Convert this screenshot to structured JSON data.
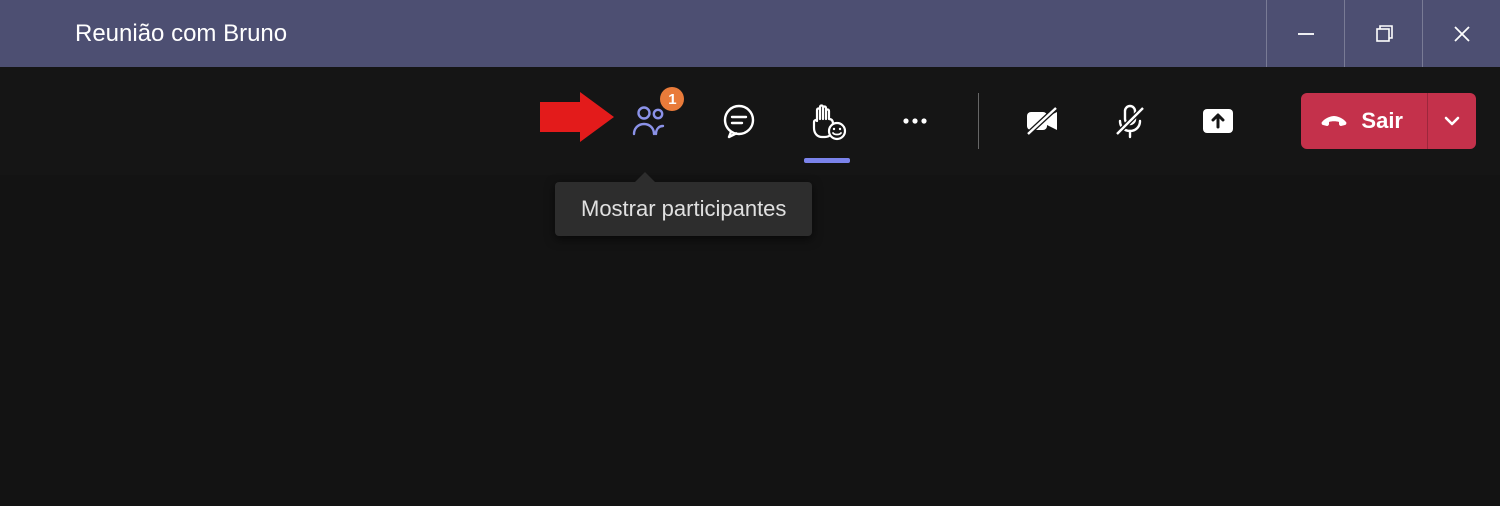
{
  "titlebar": {
    "title": "Reunião com Bruno"
  },
  "toolbar": {
    "participants_badge": "1",
    "leave_label": "Sair"
  },
  "tooltip": {
    "participants": "Mostrar participantes"
  }
}
